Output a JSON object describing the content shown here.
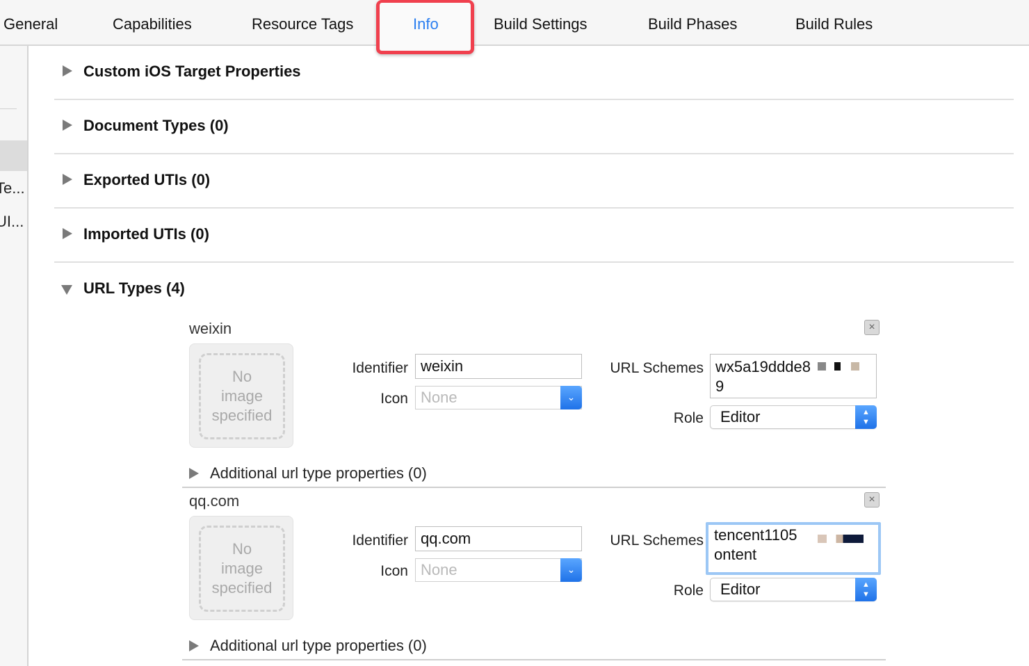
{
  "tabs": [
    {
      "label": "General"
    },
    {
      "label": "Capabilities"
    },
    {
      "label": "Resource Tags"
    },
    {
      "label": "Info"
    },
    {
      "label": "Build Settings"
    },
    {
      "label": "Build Phases"
    },
    {
      "label": "Build Rules"
    }
  ],
  "active_tab": "Info",
  "sidebar": {
    "items": [
      {
        "label": "Te..."
      },
      {
        "label": "UI..."
      }
    ]
  },
  "sections": [
    {
      "title": "Custom iOS Target Properties"
    },
    {
      "title": "Document Types (0)"
    },
    {
      "title": "Exported UTIs (0)"
    },
    {
      "title": "Imported UTIs (0)"
    },
    {
      "title": "URL Types (4)"
    }
  ],
  "labels": {
    "identifier": "Identifier",
    "icon": "Icon",
    "url_schemes": "URL Schemes",
    "role": "Role",
    "no_image_line1": "No",
    "no_image_line2": "image",
    "no_image_line3": "specified",
    "additional": "Additional url type properties (0)"
  },
  "url_types": [
    {
      "name": "weixin",
      "identifier": "weixin",
      "icon": "None",
      "url_schemes": "wx5a19ddde8\n9",
      "role": "Editor"
    },
    {
      "name": "qq.com",
      "identifier": "qq.com",
      "icon": "None",
      "url_schemes": "tencent1105\nontent",
      "role": "Editor"
    }
  ],
  "icons": {
    "remove": "remove-x-icon",
    "disclosure": "disclosure-triangle-icon",
    "dropdown": "chevron-down-icon",
    "stepper": "up-down-chevrons-icon"
  },
  "colors": {
    "active_tab": "#2a7ef0",
    "highlight_box": "#f0404e",
    "control_blue": "#1f72e8"
  }
}
